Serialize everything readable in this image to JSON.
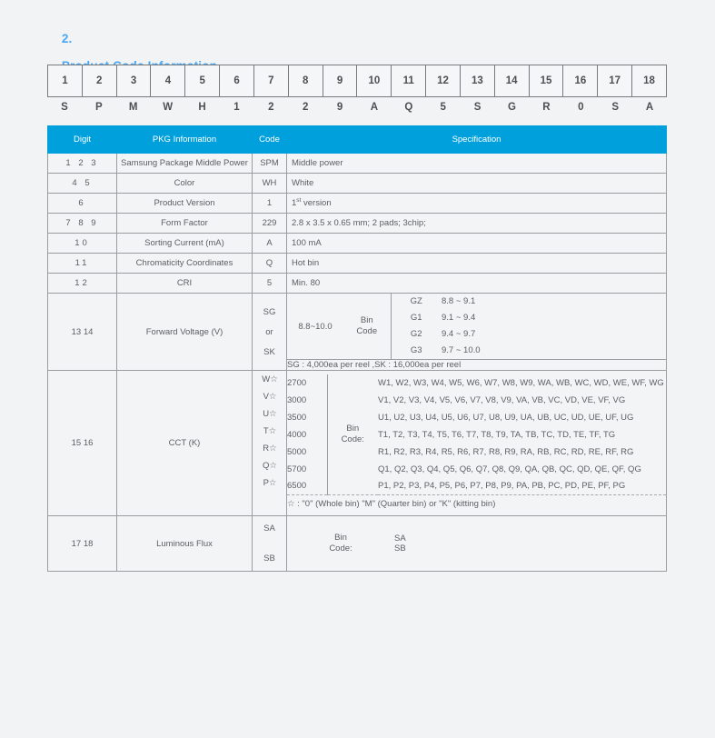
{
  "section": {
    "number": "2.",
    "title": "Product Code Information",
    "accent_color": "#49a7f5"
  },
  "code_strip": {
    "digits": [
      "1",
      "2",
      "3",
      "4",
      "5",
      "6",
      "7",
      "8",
      "9",
      "10",
      "11",
      "12",
      "13",
      "14",
      "15",
      "16",
      "17",
      "18"
    ],
    "letters": [
      "S",
      "P",
      "M",
      "W",
      "H",
      "1",
      "2",
      "2",
      "9",
      "A",
      "Q",
      "5",
      "S",
      "G",
      "R",
      "0",
      "S",
      "A"
    ]
  },
  "table": {
    "header_color": "#00a0dd",
    "headers": {
      "digit": "Digit",
      "pkg": "PKG Information",
      "code": "Code",
      "spec": "Specification"
    },
    "rows": [
      {
        "digit": "1  2  3",
        "pkg": "Samsung Package Middle Power",
        "code": "SPM",
        "spec": "Middle power"
      },
      {
        "digit": "4  5",
        "pkg": "Color",
        "code": "WH",
        "spec": "White"
      },
      {
        "digit": "6",
        "pkg": "Product Version",
        "code": "1",
        "spec_pre": "1",
        "spec_sup": "st",
        "spec_post": " version"
      },
      {
        "digit": "7  8  9",
        "pkg": "Form Factor",
        "code": "229",
        "spec": "2.8 x 3.5 x 0.65 mm;   2 pads;   3chip;"
      },
      {
        "digit": "10",
        "pkg": "Sorting Current (mA)",
        "code": "A",
        "spec": "100 mA"
      },
      {
        "digit": "11",
        "pkg": "Chromaticity Coordinates",
        "code": "Q",
        "spec": "Hot bin"
      },
      {
        "digit": "12",
        "pkg": "CRI",
        "code": "5",
        "spec": "Min. 80"
      }
    ],
    "forward_voltage": {
      "digit": "13  14",
      "pkg": "Forward Voltage (V)",
      "codes": [
        "SG",
        "or",
        "SK"
      ],
      "range": "8.8~10.0",
      "bin_label_line1": "Bin",
      "bin_label_line2": "Code",
      "bins": [
        {
          "code": "GZ",
          "range": "8.8 ~ 9.1"
        },
        {
          "code": "G1",
          "range": "9.1 ~ 9.4"
        },
        {
          "code": "G2",
          "range": "9.4 ~ 9.7"
        },
        {
          "code": "G3",
          "range": "9.7 ~ 10.0"
        }
      ],
      "reel_note": "SG : 4,000ea per reel ,SK : 16,000ea per reel"
    },
    "cct": {
      "digit": "15  16",
      "pkg": "CCT (K)",
      "bin_label_line1": "Bin",
      "bin_label_line2": "Code:",
      "rows": [
        {
          "code": "W☆",
          "k": "2700",
          "list": "W1, W2, W3, W4, W5, W6, W7, W8, W9, WA, WB, WC, WD, WE, WF, WG"
        },
        {
          "code": "V☆",
          "k": "3000",
          "list": "V1, V2, V3, V4, V5, V6, V7, V8, V9, VA, VB, VC, VD, VE, VF, VG"
        },
        {
          "code": "U☆",
          "k": "3500",
          "list": "U1, U2, U3, U4, U5, U6, U7, U8, U9, UA, UB, UC, UD, UE, UF, UG"
        },
        {
          "code": "T☆",
          "k": "4000",
          "list": "T1, T2, T3, T4, T5, T6, T7, T8, T9, TA, TB, TC, TD, TE, TF, TG"
        },
        {
          "code": "R☆",
          "k": "5000",
          "list": "R1, R2, R3, R4, R5, R6, R7, R8, R9, RA, RB, RC, RD, RE, RF, RG"
        },
        {
          "code": "Q☆",
          "k": "5700",
          "list": "Q1, Q2, Q3, Q4, Q5, Q6, Q7, Q8, Q9, QA, QB, QC, QD, QE, QF, QG"
        },
        {
          "code": "P☆",
          "k": "6500",
          "list": "P1, P2, P3, P4, P5, P6, P7, P8, P9, PA, PB, PC, PD, PE, PF, PG"
        }
      ],
      "footnote": "☆ :   \"0\" (Whole bin)    \"M\" (Quarter bin) or    \"K\" (kitting bin)"
    },
    "luminous_flux": {
      "digit": "17  18",
      "pkg": "Luminous Flux",
      "codes": [
        "SA",
        "SB"
      ],
      "bin_label_line1": "Bin",
      "bin_label_line2": "Code:",
      "values": [
        "SA",
        "SB"
      ]
    }
  }
}
